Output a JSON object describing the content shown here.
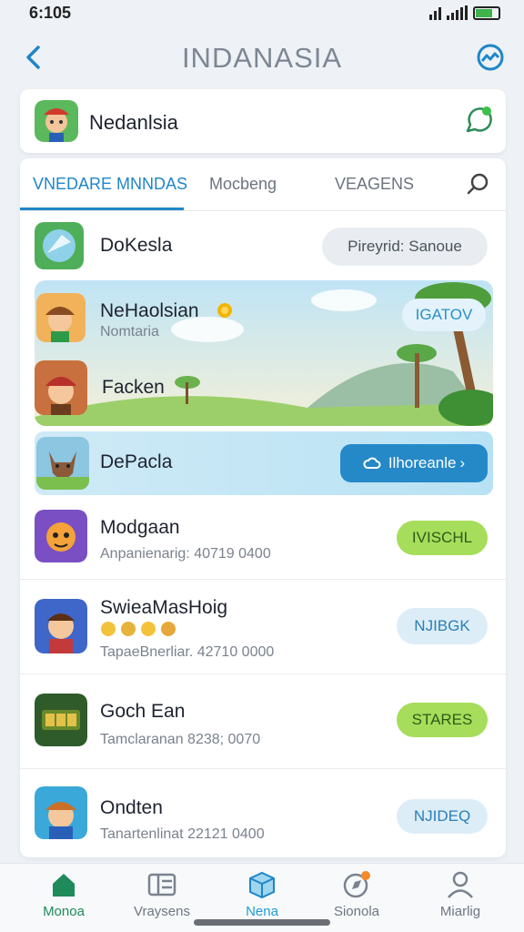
{
  "status": {
    "time": "6:105"
  },
  "header": {
    "title": "INDANASIA"
  },
  "profile": {
    "name": "Nedanlsia"
  },
  "tabs": [
    {
      "label": "VNEDARE MNNDAS"
    },
    {
      "label": "Mocbeng"
    },
    {
      "label": "VEAGENS"
    }
  ],
  "rows": [
    {
      "name": "DoKesla",
      "action": "Pireyrid: Sanoue"
    },
    {
      "name": "NeHaolsian",
      "subtitle": "Nomtaria",
      "action": "IGATOV"
    },
    {
      "name": "Facken"
    },
    {
      "name": "DePacla",
      "action": "Ilhoreanle"
    },
    {
      "name": "Modgaan",
      "subtitle": "Anpanienarig: 40719 0400",
      "action": "IVISCHL"
    },
    {
      "name": "SwieaMasHoig",
      "subtitle": "TapaeBnerliar. 42710 0000",
      "action": "NJIBGK"
    },
    {
      "name": "Goch Ean",
      "subtitle": "Tamclaranan 8238; 0070",
      "action": "STARES"
    },
    {
      "name": "Ondten",
      "subtitle": "Tanartenlinat 22121 0400",
      "action": "NJIDEQ"
    }
  ],
  "nav": [
    {
      "label": "Monoa"
    },
    {
      "label": "Vraysens"
    },
    {
      "label": "Nena"
    },
    {
      "label": "Sionola"
    },
    {
      "label": "Miarlig"
    }
  ],
  "colors": {
    "accent": "#1f86c8",
    "green_button": "#a6dd5a",
    "blue_button": "#dcedf8",
    "active_nav": "#1f8a5a"
  }
}
